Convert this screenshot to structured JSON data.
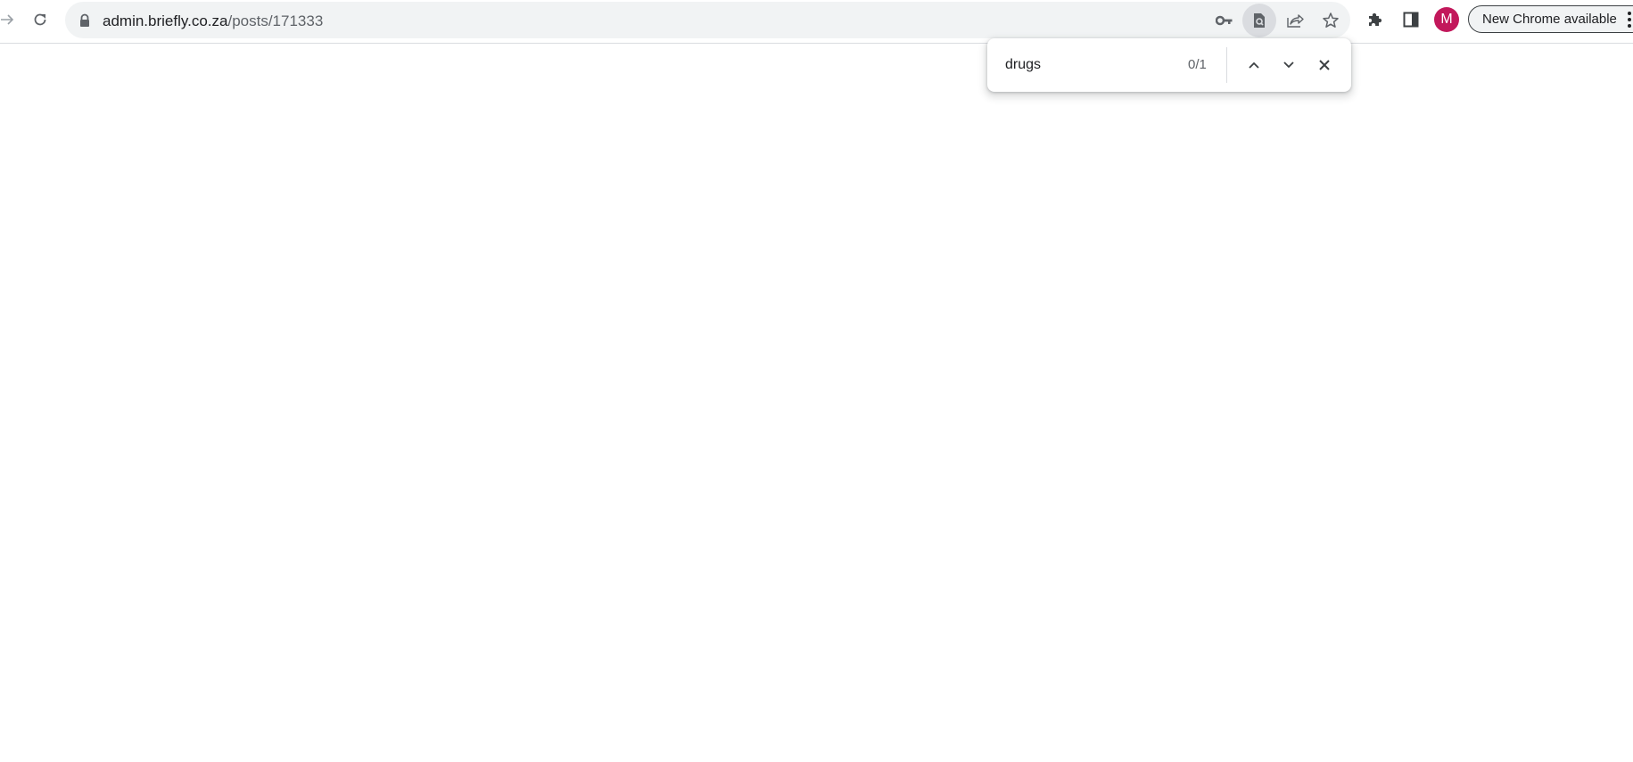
{
  "browser": {
    "address_bar": {
      "domain": "admin.briefly.co.za",
      "path": "/posts/171333"
    },
    "toolbar_icons": {
      "back": "arrow-right-icon",
      "reload": "reload-icon",
      "lock": "lock-icon",
      "password": "key-icon",
      "find": "find-in-page-icon",
      "share": "share-icon",
      "bookmark": "star-icon",
      "extensions": "puzzle-icon",
      "side_panel": "side-panel-icon",
      "menu": "kebab-menu-icon"
    },
    "profile": {
      "initial": "M",
      "color": "#c2185b"
    },
    "update_button": {
      "label": "New Chrome available"
    }
  },
  "find_bar": {
    "query": "drugs",
    "count": "0/1",
    "icons": {
      "previous": "chevron-up-icon",
      "next": "chevron-down-icon",
      "close": "close-icon"
    }
  }
}
